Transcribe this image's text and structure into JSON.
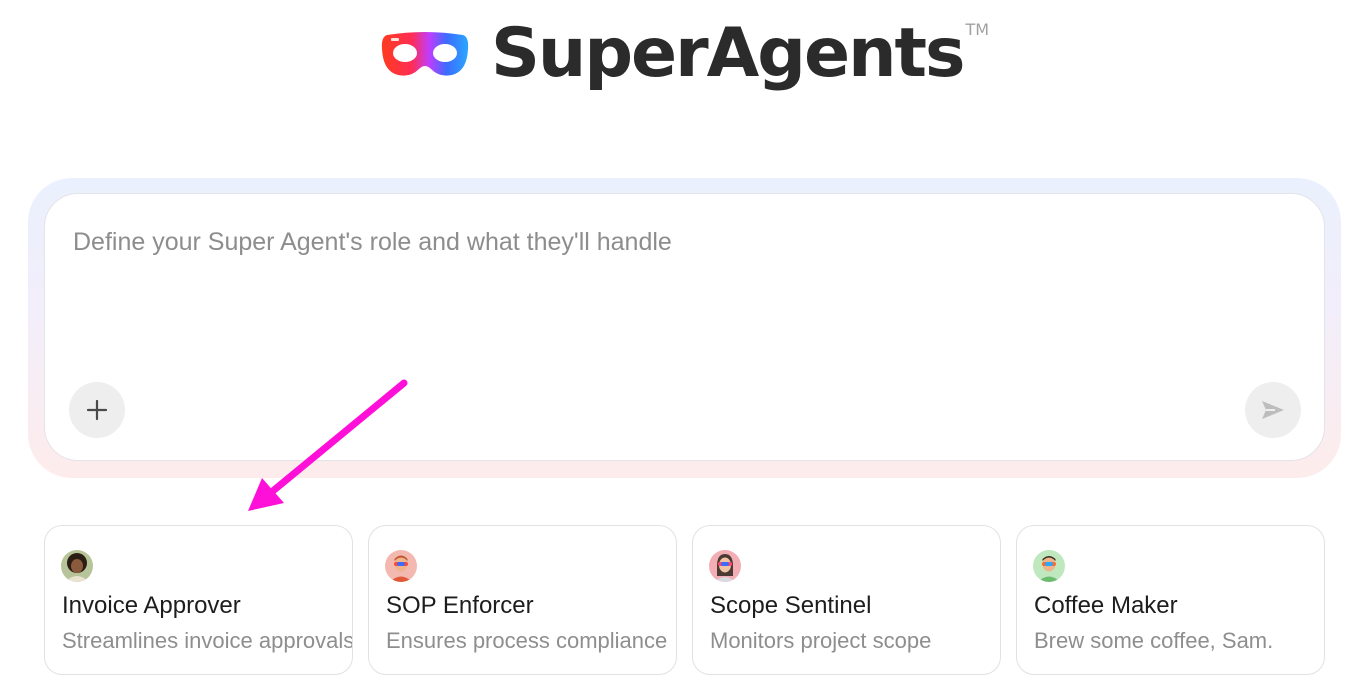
{
  "header": {
    "brand_name": "SuperAgents",
    "trademark": "TM",
    "logo_icon": "mask-logo-icon"
  },
  "composer": {
    "placeholder": "Define your Super Agent's role and what they'll handle",
    "value": "",
    "add_icon": "plus-icon",
    "send_icon": "send-icon"
  },
  "annotation": {
    "color": "#ff10d8"
  },
  "cards": [
    {
      "title": "Invoice Approver",
      "description": "Streamlines invoice approvals",
      "avatar_bg": "#b7c49a"
    },
    {
      "title": "SOP Enforcer",
      "description": "Ensures process compliance",
      "avatar_bg": "#f3b8b0"
    },
    {
      "title": "Scope Sentinel",
      "description": "Monitors project scope",
      "avatar_bg": "#f2aeb4"
    },
    {
      "title": "Coffee Maker",
      "description": "Brew some coffee, Sam.",
      "avatar_bg": "#bfe8bf"
    }
  ]
}
